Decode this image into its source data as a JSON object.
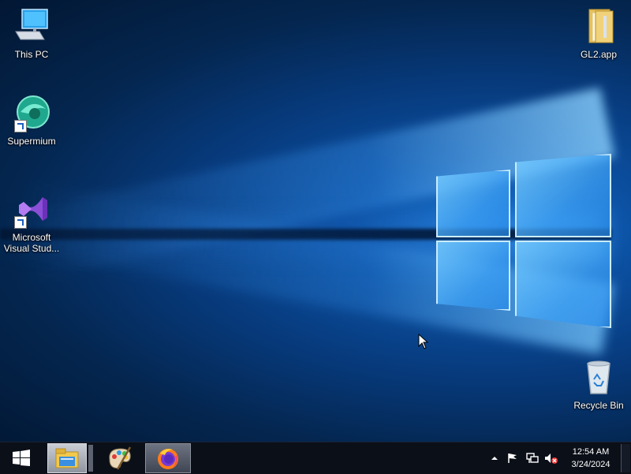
{
  "desktop": {
    "icons": [
      {
        "label": "This PC",
        "icon": "computer-icon"
      },
      {
        "label": "Supermium",
        "icon": "supermium-browser-icon"
      },
      {
        "label": "Microsoft Visual Stud...",
        "icon": "visual-studio-icon"
      },
      {
        "label": "GL2.app",
        "icon": "folder-icon"
      },
      {
        "label": "Recycle Bin",
        "icon": "recycle-bin-icon"
      }
    ]
  },
  "taskbar": {
    "start_icon": "windows-start-icon",
    "pinned": [
      {
        "name": "File Explorer",
        "icon": "file-explorer-icon",
        "active": true
      },
      {
        "name": "Paint",
        "icon": "paint-palette-icon",
        "active": false
      },
      {
        "name": "Firefox",
        "icon": "firefox-icon",
        "active": true
      }
    ],
    "tray": {
      "icons": [
        "chevron-up-icon",
        "flag-icon",
        "network-icon",
        "volume-muted-icon"
      ],
      "time": "12:54 AM",
      "date": "3/24/2024"
    }
  },
  "colors": {
    "taskbar_bg": "#0b0f18",
    "wallpaper_accent": "#1a74d4"
  }
}
